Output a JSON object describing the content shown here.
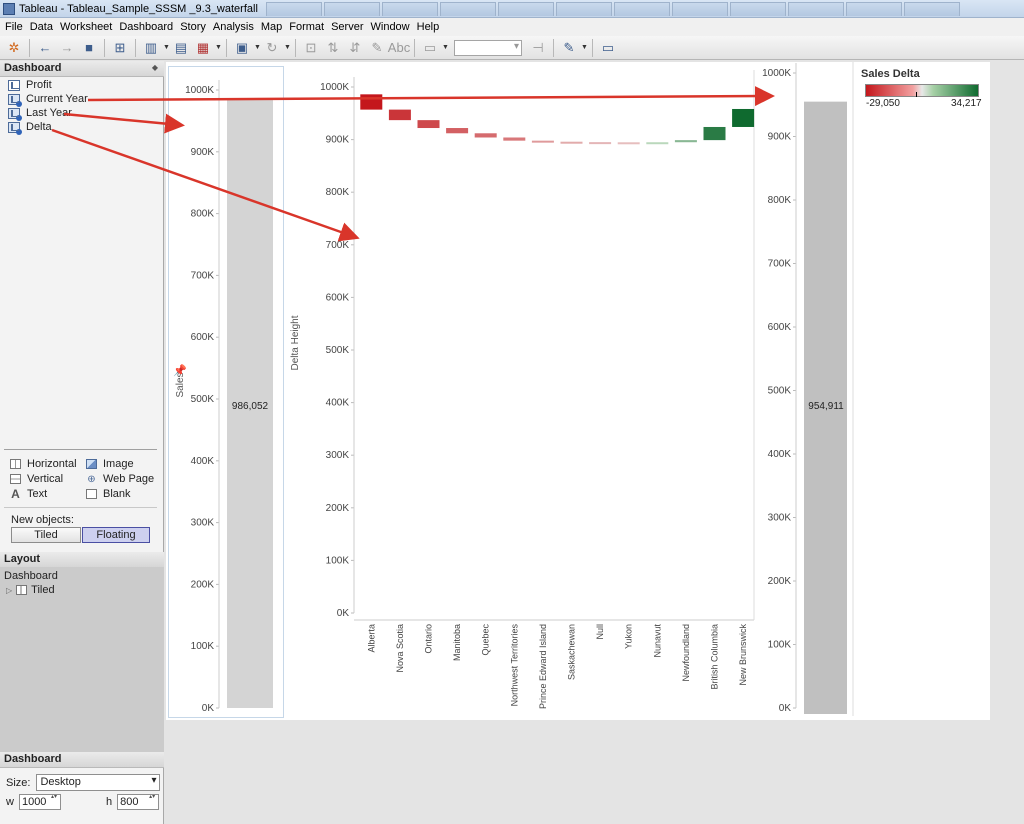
{
  "window": {
    "title": "Tableau - Tableau_Sample_SSSM _9.3_waterfall"
  },
  "menu": [
    "File",
    "Data",
    "Worksheet",
    "Dashboard",
    "Story",
    "Analysis",
    "Map",
    "Format",
    "Server",
    "Window",
    "Help"
  ],
  "toolbar": {
    "icons": [
      "tableau-logo-icon",
      "undo-icon",
      "redo-icon",
      "save-icon",
      "new-data-source-icon",
      "new-worksheet-icon",
      "duplicate-icon",
      "clear-icon",
      "swap-icon",
      "refresh-icon",
      "group-icon",
      "label-icon",
      "fit-icon",
      "highlight-icon",
      "presentation-icon"
    ]
  },
  "sidebar": {
    "header": "Dashboard",
    "sheets": [
      "Profit",
      "Current Year",
      "Last Year",
      "Delta"
    ],
    "objects": {
      "horizontal": "Horizontal",
      "image": "Image",
      "vertical": "Vertical",
      "web_page": "Web Page",
      "text": "Text",
      "blank": "Blank"
    },
    "new_objects_label": "New objects:",
    "tiled_button": "Tiled",
    "floating_button": "Floating",
    "layout_header": "Layout",
    "layout_dashboard": "Dashboard",
    "layout_tiled": "Tiled",
    "dashboard_header": "Dashboard",
    "size_label": "Size:",
    "size_value": "Desktop",
    "w_label": "w",
    "w_value": "1000",
    "h_label": "h",
    "h_value": "800"
  },
  "legend": {
    "title": "Sales Delta",
    "min": "-29,050",
    "max": "34,217",
    "colors": {
      "negative": "#c4171c",
      "positive": "#0f6a2f"
    }
  },
  "chart_data": [
    {
      "type": "bar",
      "ylabel": "Sales",
      "ylim": [
        0,
        1000000
      ],
      "yticks": [
        "0K",
        "100K",
        "200K",
        "300K",
        "400K",
        "500K",
        "600K",
        "700K",
        "800K",
        "900K",
        "1000K"
      ],
      "values": [
        986052
      ],
      "value_label": "986,052",
      "color": "#d4d4d4"
    },
    {
      "type": "waterfall",
      "ylabel": "Delta Height",
      "ylim": [
        0,
        1000000
      ],
      "yticks": [
        "0K",
        "100K",
        "200K",
        "300K",
        "400K",
        "500K",
        "600K",
        "700K",
        "800K",
        "900K",
        "1000K"
      ],
      "categories": [
        "Alberta",
        "Nova Scotia",
        "Ontario",
        "Manitoba",
        "Quebec",
        "Northwest Territories",
        "Prince Edward Island",
        "Saskachewan",
        "Null",
        "Yukon",
        "Nunavut",
        "Newfoundland",
        "British Columbia",
        "New Brunswick"
      ],
      "start": 986052,
      "deltas": [
        -29050,
        -20000,
        -15000,
        -10000,
        -8000,
        -6000,
        -2000,
        -800,
        -300,
        -100,
        200,
        4000,
        25000,
        34217
      ],
      "colors": {
        "negative": "#c4171c",
        "positive": "#0f6a2f"
      }
    },
    {
      "type": "bar",
      "ylim": [
        0,
        1000000
      ],
      "yticks": [
        "0K",
        "100K",
        "200K",
        "300K",
        "400K",
        "500K",
        "600K",
        "700K",
        "800K",
        "900K",
        "1000K"
      ],
      "values": [
        954911
      ],
      "value_label": "954,911",
      "color": "#c0c0c0"
    }
  ]
}
